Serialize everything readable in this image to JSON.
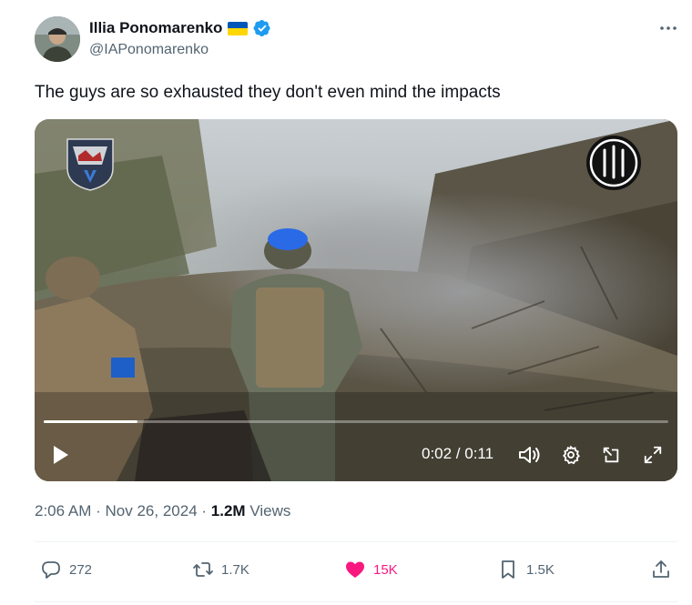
{
  "author": {
    "display_name": "Illia Ponomarenko",
    "flag_icon": "ukraine-flag",
    "verified": true,
    "handle": "@IAPonomarenko"
  },
  "tweet": {
    "text": "The guys are so exhausted they don't even mind the impacts"
  },
  "video": {
    "time": "0:02 / 0:11",
    "progress": 0.15
  },
  "meta": {
    "time": "2:06 AM",
    "sep1": "·",
    "date": "Nov 26, 2024",
    "sep2": "·",
    "views_count": "1.2M",
    "views_label": "Views"
  },
  "actions": {
    "replies": "272",
    "reposts": "1.7K",
    "likes": "15K",
    "bookmarks": "1.5K"
  },
  "colors": {
    "accent_like": "#f91880",
    "verified": "#1d9bf0",
    "muted": "#536471",
    "text": "#0f1419"
  }
}
